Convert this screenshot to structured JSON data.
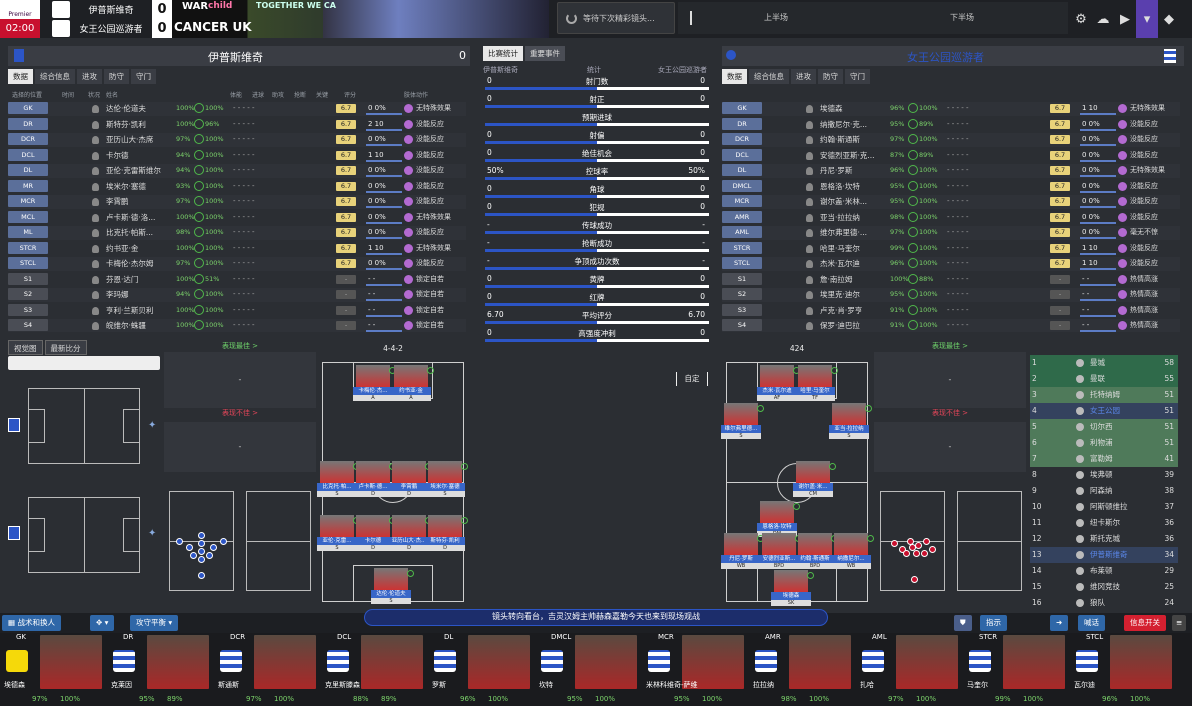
{
  "scoreboard": {
    "competition": "Premier",
    "home_name": "伊普斯维奇",
    "home_score": "0",
    "away_name": "女王公园巡游者",
    "away_score": "0",
    "clock": "02:00"
  },
  "ads": {
    "a1": "WAR",
    "a2": "child",
    "a3": "TOGETHER WE CA",
    "a4": "CANCER UK"
  },
  "notify": {
    "text": "等待下次精彩镜头..."
  },
  "halves": {
    "first": "上半场",
    "second": "下半场"
  },
  "home": {
    "title": "伊普斯维奇",
    "score": "0",
    "tabs": [
      "数据",
      "综合信息",
      "进攻",
      "防守",
      "守门"
    ],
    "columns": {
      "c1": "选择的位置",
      "c2": "时间",
      "c3": "状况",
      "c4": "姓名",
      "c5": "",
      "c6": "",
      "c7": "体能",
      "c8": "进球",
      "c9": "助攻",
      "c10": "抢断",
      "c11": "关键",
      "c12": "评分",
      "c13": "肢体动作"
    },
    "players": [
      {
        "pos": "GK",
        "name": "达伦·伦道夫",
        "fit": "100%",
        "cond": "100%",
        "rating": "6.7",
        "s2": "0 0%",
        "react": "无特殊效果"
      },
      {
        "pos": "DR",
        "name": "斯特芬·凯利",
        "fit": "100%",
        "cond": "96%",
        "rating": "6.7",
        "s2": "2 10",
        "react": "没能反应"
      },
      {
        "pos": "DCR",
        "name": "亚历山大·杰席",
        "fit": "97%",
        "cond": "100%",
        "rating": "6.7",
        "s2": "0 0%",
        "react": "没能反应"
      },
      {
        "pos": "DCL",
        "name": "卡尔德",
        "fit": "94%",
        "cond": "100%",
        "rating": "6.7",
        "s2": "1 10",
        "react": "没能反应"
      },
      {
        "pos": "DL",
        "name": "亚伦·克雷斯维尔",
        "fit": "94%",
        "cond": "100%",
        "rating": "6.7",
        "s2": "0 0%",
        "react": "没能反应"
      },
      {
        "pos": "MR",
        "name": "埃米尔·塞德",
        "fit": "93%",
        "cond": "100%",
        "rating": "6.7",
        "s2": "0 0%",
        "react": "没能反应"
      },
      {
        "pos": "MCR",
        "name": "李霄鹏",
        "fit": "97%",
        "cond": "100%",
        "rating": "6.7",
        "s2": "0 0%",
        "react": "没能反应"
      },
      {
        "pos": "MCL",
        "name": "卢卡斯·德·洛...",
        "fit": "100%",
        "cond": "100%",
        "rating": "6.7",
        "s2": "0 0%",
        "react": "无特殊效果"
      },
      {
        "pos": "ML",
        "name": "比克托·帕斯...",
        "fit": "98%",
        "cond": "100%",
        "rating": "6.7",
        "s2": "0 0%",
        "react": "没能反应"
      },
      {
        "pos": "STCR",
        "name": "约书亚·金",
        "fit": "100%",
        "cond": "100%",
        "rating": "6.7",
        "s2": "1 10",
        "react": "无特殊效果"
      },
      {
        "pos": "STCL",
        "name": "卡梅伦·杰尔姆",
        "fit": "97%",
        "cond": "100%",
        "rating": "6.7",
        "s2": "0 0%",
        "react": "没能反应"
      },
      {
        "pos": "S1",
        "name": "芬恩·达门",
        "fit": "100%",
        "cond": "51%",
        "rating": "-",
        "s2": "- -",
        "react": "锁定自若"
      },
      {
        "pos": "S2",
        "name": "李玛娜",
        "fit": "94%",
        "cond": "100%",
        "rating": "-",
        "s2": "- -",
        "react": "锁定自若"
      },
      {
        "pos": "S3",
        "name": "亨利·兰斯贝利",
        "fit": "100%",
        "cond": "100%",
        "rating": "-",
        "s2": "- -",
        "react": "锁定自若"
      },
      {
        "pos": "S4",
        "name": "皖维尔·蛛疆",
        "fit": "100%",
        "cond": "100%",
        "rating": "-",
        "s2": "- -",
        "react": "锁定自若"
      }
    ]
  },
  "away": {
    "title": "女王公园巡游者",
    "score": "0",
    "tabs": [
      "数据",
      "综合信息",
      "进攻",
      "防守",
      "守门"
    ],
    "players": [
      {
        "pos": "GK",
        "name": "埃德森",
        "fit": "96%",
        "cond": "100%",
        "rating": "6.7",
        "s2": "1 10",
        "react": "无特殊效果"
      },
      {
        "pos": "DR",
        "name": "纳撒尼尔·克...",
        "fit": "95%",
        "cond": "89%",
        "rating": "6.7",
        "s2": "0 0%",
        "react": "没能反应"
      },
      {
        "pos": "DCR",
        "name": "约翰·斯通斯",
        "fit": "97%",
        "cond": "100%",
        "rating": "6.7",
        "s2": "0 0%",
        "react": "没能反应"
      },
      {
        "pos": "DCL",
        "name": "安德烈亚斯·克...",
        "fit": "87%",
        "cond": "89%",
        "rating": "6.7",
        "s2": "0 0%",
        "react": "没能反应"
      },
      {
        "pos": "DL",
        "name": "丹尼·罗斯",
        "fit": "96%",
        "cond": "100%",
        "rating": "6.7",
        "s2": "0 0%",
        "react": "无特殊效果"
      },
      {
        "pos": "DMCL",
        "name": "恩格洛·坎特",
        "fit": "95%",
        "cond": "100%",
        "rating": "6.7",
        "s2": "0 0%",
        "react": "没能反应"
      },
      {
        "pos": "MCR",
        "name": "谢尔盖·米林...",
        "fit": "95%",
        "cond": "100%",
        "rating": "6.7",
        "s2": "0 0%",
        "react": "没能反应"
      },
      {
        "pos": "AMR",
        "name": "亚当·拉拉纳",
        "fit": "98%",
        "cond": "100%",
        "rating": "6.7",
        "s2": "0 0%",
        "react": "没能反应"
      },
      {
        "pos": "AML",
        "name": "维尔弗里德·...",
        "fit": "97%",
        "cond": "100%",
        "rating": "6.7",
        "s2": "0 0%",
        "react": "毫无不惊"
      },
      {
        "pos": "STCR",
        "name": "哈里·马奎尔",
        "fit": "99%",
        "cond": "100%",
        "rating": "6.7",
        "s2": "1 10",
        "react": "没能反应"
      },
      {
        "pos": "STCL",
        "name": "杰米·瓦尔迪",
        "fit": "96%",
        "cond": "100%",
        "rating": "6.7",
        "s2": "1 10",
        "react": "没能反应"
      },
      {
        "pos": "S1",
        "name": "詹·南拉姆",
        "fit": "100%",
        "cond": "88%",
        "rating": "-",
        "s2": "- -",
        "react": "热情高涨"
      },
      {
        "pos": "S2",
        "name": "埃里克·迪尔",
        "fit": "95%",
        "cond": "100%",
        "rating": "-",
        "s2": "- -",
        "react": "热情高涨"
      },
      {
        "pos": "S3",
        "name": "卢克·肖·罗亨",
        "fit": "91%",
        "cond": "100%",
        "rating": "-",
        "s2": "- -",
        "react": "热情高涨"
      },
      {
        "pos": "S4",
        "name": "保罗·迪巴拉",
        "fit": "91%",
        "cond": "100%",
        "rating": "-",
        "s2": "- -",
        "react": "热情高涨"
      }
    ]
  },
  "stats": {
    "tabs": [
      "比赛统计",
      "重要事件"
    ],
    "home_label": "伊普斯维奇",
    "mid_label": "统计",
    "away_label": "女王公园巡游者",
    "rows": [
      {
        "label": "射门数",
        "h": "0",
        "a": "0",
        "frac": 0.5
      },
      {
        "label": "射正",
        "h": "0",
        "a": "0",
        "frac": 0.5
      },
      {
        "label": "预期进球",
        "h": "",
        "a": "",
        "frac": 0.5
      },
      {
        "label": "射偏",
        "h": "0",
        "a": "0",
        "frac": 0.5
      },
      {
        "label": "绝佳机会",
        "h": "0",
        "a": "0",
        "frac": 0.5
      },
      {
        "label": "控球率",
        "h": "50%",
        "a": "50%",
        "frac": 0.5
      },
      {
        "label": "角球",
        "h": "0",
        "a": "0",
        "frac": 0.5
      },
      {
        "label": "犯规",
        "h": "0",
        "a": "0",
        "frac": 0.5
      },
      {
        "label": "传球成功",
        "h": "-",
        "a": "-",
        "frac": 0.5
      },
      {
        "label": "抢断成功",
        "h": "-",
        "a": "-",
        "frac": 0.5
      },
      {
        "label": "争顶成功次数",
        "h": "-",
        "a": "-",
        "frac": 0.5
      },
      {
        "label": "黄牌",
        "h": "0",
        "a": "0",
        "frac": 0.5
      },
      {
        "label": "红牌",
        "h": "0",
        "a": "0",
        "frac": 0.5
      },
      {
        "label": "平均评分",
        "h": "6.70",
        "a": "6.70",
        "frac": 0.5
      },
      {
        "label": "高强度冲刺",
        "h": "0",
        "a": "0",
        "frac": 0.5
      }
    ]
  },
  "lower": {
    "tabs": [
      "视觉图",
      "最新比分"
    ],
    "best_label": "表现最佳 >",
    "worst_label": "表现不佳 >",
    "dash": "-",
    "home_formation": "4-4-2",
    "away_formation": "424",
    "custom_btn": "自定"
  },
  "home_pitch": [
    {
      "n": "卡梅伦·杰...",
      "s": "A"
    },
    {
      "n": "约书亚·金",
      "s": "A"
    },
    {
      "n": "比克托·帕...",
      "s": "S"
    },
    {
      "n": "卢卡斯·德...",
      "s": "D"
    },
    {
      "n": "李霄鹏",
      "s": "D"
    },
    {
      "n": "埃米尔·塞德",
      "s": "S"
    },
    {
      "n": "亚伦·克雷...",
      "s": "S"
    },
    {
      "n": "卡尔德",
      "s": "D"
    },
    {
      "n": "亚历山大·杰...",
      "s": "D"
    },
    {
      "n": "斯特芬·凯利",
      "s": "D"
    },
    {
      "n": "达伦·伦道夫",
      "s": "S"
    }
  ],
  "away_pitch": [
    {
      "n": "杰米·瓦尔迪",
      "s": "AF"
    },
    {
      "n": "哈里·马奎尔",
      "s": "TF"
    },
    {
      "n": "维尔弗里德...",
      "s": "S"
    },
    {
      "n": "亚当·拉拉纳",
      "s": "S"
    },
    {
      "n": "谢尔盖·米...",
      "s": "CM"
    },
    {
      "n": "恩格洛·坎特",
      "s": "DM"
    },
    {
      "n": "丹尼·罗斯",
      "s": "WB"
    },
    {
      "n": "安德烈亚斯...",
      "s": "BPD"
    },
    {
      "n": "约翰·斯通斯",
      "s": "BPD"
    },
    {
      "n": "纳撒尼尔...",
      "s": "WB"
    },
    {
      "n": "埃德森",
      "s": "SK"
    }
  ],
  "league": {
    "headers": [
      "排名",
      "球队",
      "积分"
    ],
    "rows": [
      {
        "r": "1",
        "t": "曼城",
        "p": "58"
      },
      {
        "r": "2",
        "t": "曼联",
        "p": "55"
      },
      {
        "r": "3",
        "t": "托特纳姆",
        "p": "51"
      },
      {
        "r": "4",
        "t": "女王公园",
        "p": "51"
      },
      {
        "r": "5",
        "t": "切尔西",
        "p": "51"
      },
      {
        "r": "6",
        "t": "利物浦",
        "p": "51"
      },
      {
        "r": "7",
        "t": "富勒姆",
        "p": "41"
      },
      {
        "r": "8",
        "t": "埃弗顿",
        "p": "39"
      },
      {
        "r": "9",
        "t": "阿森纳",
        "p": "38"
      },
      {
        "r": "10",
        "t": "阿斯顿维拉",
        "p": "37"
      },
      {
        "r": "11",
        "t": "纽卡斯尔",
        "p": "36"
      },
      {
        "r": "12",
        "t": "斯托克城",
        "p": "36"
      },
      {
        "r": "13",
        "t": "伊普斯维奇",
        "p": "34"
      },
      {
        "r": "14",
        "t": "布莱顿",
        "p": "29"
      },
      {
        "r": "15",
        "t": "维冈竞技",
        "p": "25"
      },
      {
        "r": "16",
        "t": "狼队",
        "p": "24"
      }
    ]
  },
  "bottom": {
    "tactics": "战术和换人",
    "mentality": "攻守平衡",
    "ticker": "镜头转向看台，吉灵汉姆主帅赫森嘉勒今天也来到现场观战",
    "instructions": "指示",
    "talk": "喊话",
    "info": "信息开关"
  },
  "strip": [
    {
      "pos": "GK",
      "name": "埃德森",
      "fit": "97%",
      "cond": "100%"
    },
    {
      "pos": "DR",
      "name": "克莱因",
      "fit": "95%",
      "cond": "89%"
    },
    {
      "pos": "DCR",
      "name": "斯通斯",
      "fit": "97%",
      "cond": "100%"
    },
    {
      "pos": "DCL",
      "name": "克里斯滕森",
      "fit": "88%",
      "cond": "89%"
    },
    {
      "pos": "DL",
      "name": "罗斯",
      "fit": "96%",
      "cond": "100%"
    },
    {
      "pos": "DMCL",
      "name": "坎特",
      "fit": "95%",
      "cond": "100%"
    },
    {
      "pos": "MCR",
      "name": "米林科维奇-萨维",
      "fit": "95%",
      "cond": "100%"
    },
    {
      "pos": "AMR",
      "name": "拉拉纳",
      "fit": "98%",
      "cond": "100%"
    },
    {
      "pos": "AML",
      "name": "扎哈",
      "fit": "97%",
      "cond": "100%"
    },
    {
      "pos": "STCR",
      "name": "马奎尔",
      "fit": "99%",
      "cond": "100%"
    },
    {
      "pos": "STCL",
      "name": "瓦尔迪",
      "fit": "96%",
      "cond": "100%"
    }
  ],
  "colors": {
    "accent": "#2c55c6",
    "rating": "#e8d27a",
    "fitness": "#7cd36b",
    "clock": "#c8102e"
  }
}
